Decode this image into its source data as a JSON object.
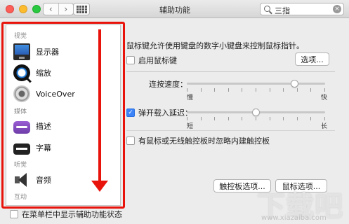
{
  "window": {
    "title": "辅助功能"
  },
  "search": {
    "value": "三指"
  },
  "sidebar": {
    "sections": [
      {
        "label": "视觉"
      },
      {
        "label": "媒体"
      },
      {
        "label": "听觉"
      },
      {
        "label": "互动"
      }
    ],
    "items": [
      {
        "label": "显示器",
        "icon": "display-icon"
      },
      {
        "label": "缩放",
        "icon": "zoom-icon"
      },
      {
        "label": "VoiceOver",
        "icon": "voiceover-icon"
      },
      {
        "label": "描述",
        "icon": "descriptions-icon"
      },
      {
        "label": "字幕",
        "icon": "captions-icon"
      },
      {
        "label": "音频",
        "icon": "audio-icon"
      }
    ]
  },
  "footer": {
    "show_in_menubar_label": "在菜单栏中显示辅助功能状态",
    "show_in_menubar_checked": false
  },
  "main": {
    "description": "鼠标键允许使用键盘的数字小键盘来控制鼠标指针。",
    "enable_mouse_keys_label": "启用鼠标键",
    "enable_mouse_keys_checked": false,
    "options_button": "选项...",
    "speed": {
      "label": "连按速度：",
      "min_label": "慢",
      "max_label": "快",
      "value": 0.78
    },
    "spring_delay": {
      "label": "弹开载入延迟：",
      "checked": true,
      "min_label": "短",
      "max_label": "长",
      "value": 0.5
    },
    "ignore_trackpad_label": "有鼠标或无线触控板时忽略内建触控板",
    "ignore_trackpad_checked": false,
    "trackpad_options_button": "触控板选项...",
    "mouse_options_button": "鼠标选项..."
  },
  "watermark": {
    "text": "下载吧",
    "url": "www.xiazaiba.com"
  },
  "colors": {
    "annotation_red": "#e8140c",
    "checkbox_blue": "#3b83f7"
  }
}
